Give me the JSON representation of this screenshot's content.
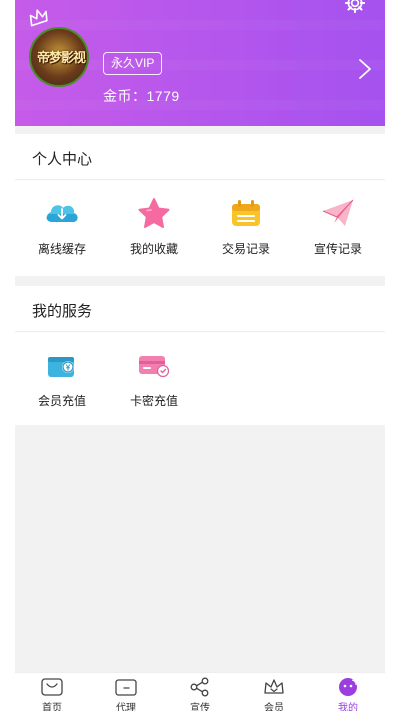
{
  "header": {
    "avatar_text": "帝梦影视",
    "vip_label": "永久VIP",
    "coins_label": "金币：",
    "coins_value": "1779"
  },
  "personal": {
    "title": "个人中心",
    "items": [
      {
        "label": "离线缓存",
        "icon": "cloud-download-icon"
      },
      {
        "label": "我的收藏",
        "icon": "star-icon"
      },
      {
        "label": "交易记录",
        "icon": "calendar-icon"
      },
      {
        "label": "宣传记录",
        "icon": "paper-plane-icon"
      }
    ]
  },
  "service": {
    "title": "我的服务",
    "items": [
      {
        "label": "会员充值",
        "icon": "wallet-icon"
      },
      {
        "label": "卡密充值",
        "icon": "card-icon"
      }
    ]
  },
  "nav": [
    {
      "label": "首页",
      "icon": "home-icon"
    },
    {
      "label": "代理",
      "icon": "wallet-nav-icon"
    },
    {
      "label": "宣传",
      "icon": "share-icon"
    },
    {
      "label": "会员",
      "icon": "crown-icon"
    },
    {
      "label": "我的",
      "icon": "profile-icon",
      "active": true
    }
  ],
  "colors": {
    "header_start": "#c65be9",
    "header_end": "#a552ef",
    "active_nav": "#9b3ee0"
  }
}
